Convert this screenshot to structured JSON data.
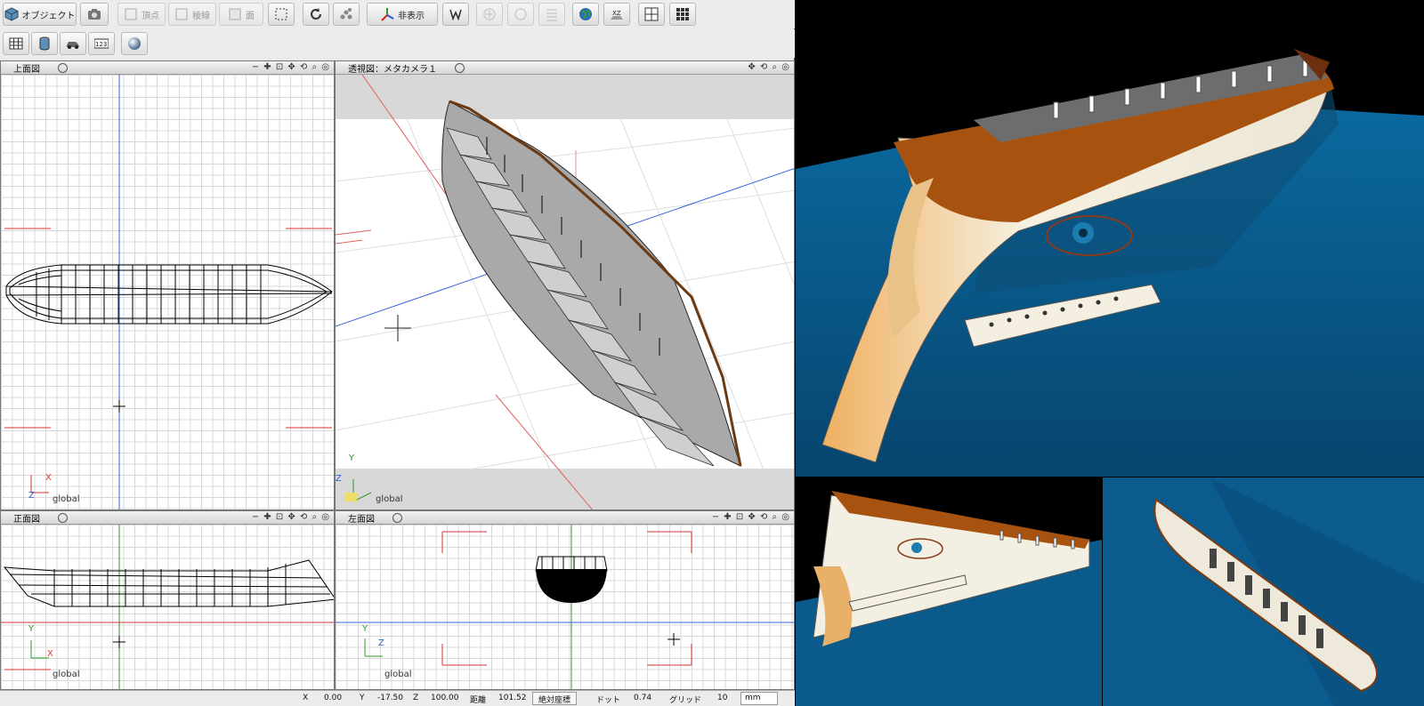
{
  "toolbar1": {
    "object_label": "オブジェクト",
    "vertex_label": "頂点",
    "edge_label": "稜線",
    "face_label": "面",
    "hide_label": "非表示"
  },
  "panes": {
    "top": {
      "title": "上面図",
      "axis_label": "global",
      "axis_a": "X",
      "axis_b": "Z"
    },
    "perspective": {
      "title": "透視図：メタカメラ１",
      "axis_label": "global",
      "axis_a": "Y",
      "axis_b": "Z"
    },
    "front": {
      "title": "正面図",
      "axis_label": "global",
      "axis_a": "Y",
      "axis_b": "X"
    },
    "left": {
      "title": "左面図",
      "axis_label": "global",
      "axis_a": "Y",
      "axis_b": "Z"
    }
  },
  "status": {
    "x_label": "X",
    "x_value": "0.00",
    "y_label": "Y",
    "y_value": "-17.50",
    "z_label": "Z",
    "z_value": "100.00",
    "dist_label": "距離",
    "dist_value": "101.52",
    "coord_mode": "絶対座標",
    "dot_label": "ドット",
    "dot_value": "0.74",
    "grid_label": "グリッド",
    "grid_value": "10",
    "unit": "mm"
  },
  "colors": {
    "water": "#0a5a8c",
    "hull_top": "#a8520f",
    "hull_white": "#f3efe3",
    "eye": "#1a7fb0"
  },
  "icons": [
    "cube-icon",
    "camera-icon",
    "vertex-icon",
    "edge-icon",
    "face-icon",
    "select-rect-icon",
    "rotate-icon",
    "node-icon",
    "hide-axis-icon",
    "wx-icon",
    "add-icon",
    "circle-icon",
    "list-icon",
    "globe-icon",
    "xz-icon",
    "layout-4-icon",
    "grid-layout-icon",
    "table-icon",
    "cylinder-icon",
    "car-icon",
    "numeric-icon",
    "sphere-icon"
  ]
}
